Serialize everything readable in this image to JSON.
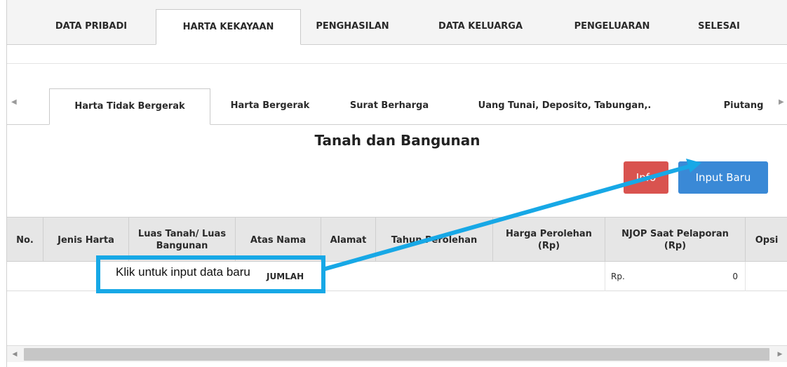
{
  "top_tabs": [
    {
      "label": "DATA PRIBADI",
      "active": false
    },
    {
      "label": "HARTA KEKAYAAN",
      "active": true
    },
    {
      "label": "PENGHASILAN",
      "active": false
    },
    {
      "label": "DATA KELUARGA",
      "active": false
    },
    {
      "label": "PENGELUARAN",
      "active": false
    },
    {
      "label": "SELESAI",
      "active": false
    }
  ],
  "sub_tabs": [
    {
      "label": "Harta Tidak Bergerak",
      "active": true
    },
    {
      "label": "Harta Bergerak",
      "active": false
    },
    {
      "label": "Surat Berharga",
      "active": false
    },
    {
      "label": "Uang Tunai, Deposito, Tabungan,.",
      "active": false
    },
    {
      "label": "Piutang",
      "active": false
    }
  ],
  "section": {
    "title": "Tanah dan Bangunan"
  },
  "buttons": {
    "info": "Info",
    "input_baru": "Input Baru"
  },
  "table": {
    "headers": [
      "No.",
      "Jenis Harta",
      "Luas Tanah/ Luas Bangunan",
      "Atas Nama",
      "Alamat",
      "Tahun Perolehan",
      "Harga Perolehan (Rp)",
      "NJOP Saat Pelaporan (Rp)",
      "Opsi"
    ],
    "total_row": {
      "label": "JUMLAH",
      "currency": "Rp.",
      "value": "0"
    }
  },
  "annotation": {
    "text": "Klik untuk input data baru"
  },
  "colors": {
    "accent_blue": "#3a89d6",
    "danger_red": "#d9534f",
    "callout_blue": "#17a8e6",
    "header_bg": "#e6e6e6"
  },
  "icons": {
    "scroll_left": "chevron-left-icon",
    "scroll_right": "chevron-right-icon"
  }
}
